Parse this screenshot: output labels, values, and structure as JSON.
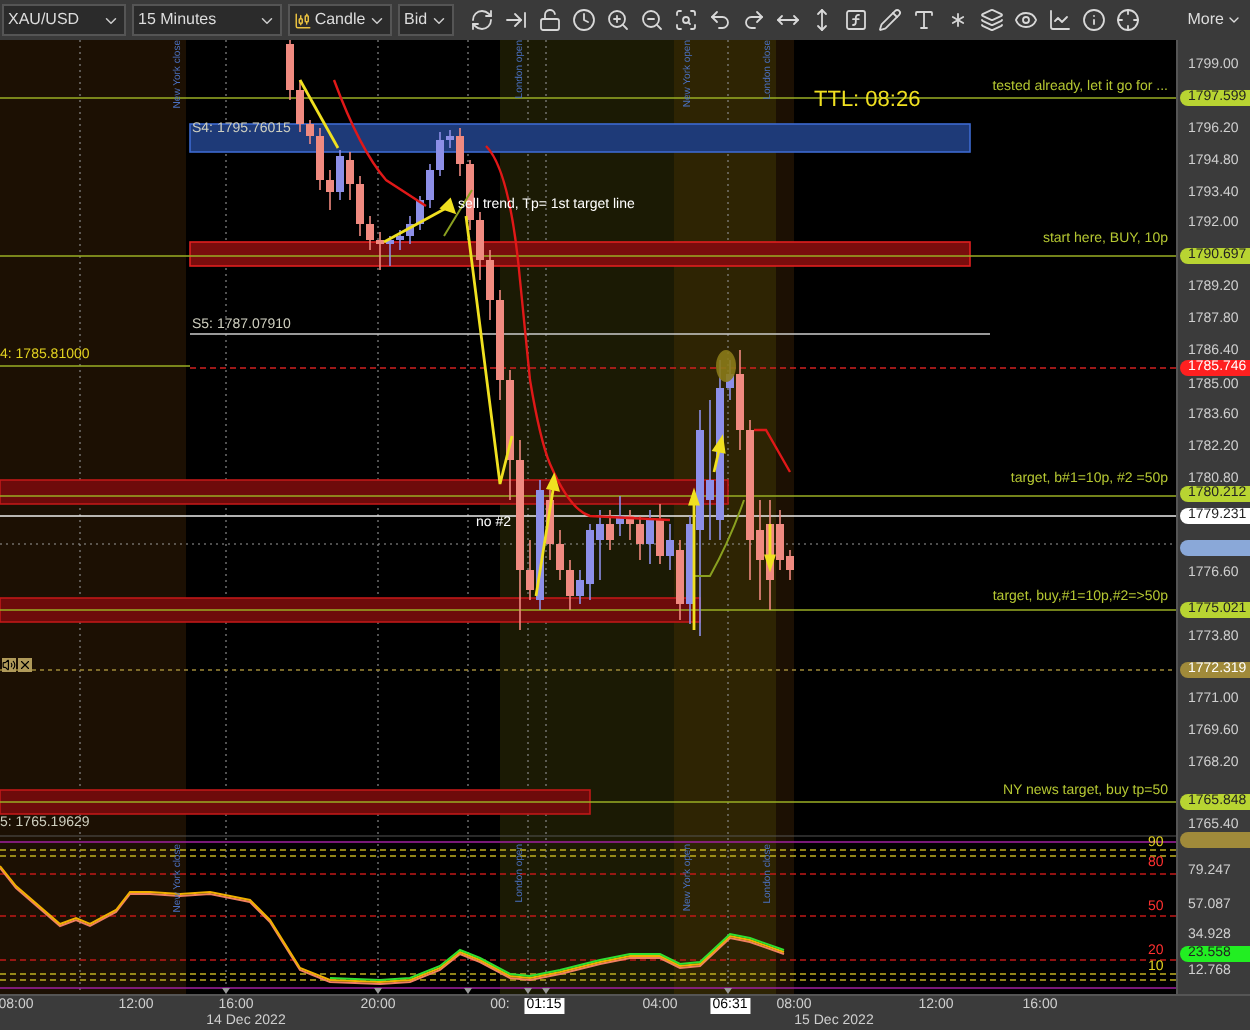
{
  "toolbar": {
    "symbol": "XAU/USD",
    "timeframe": "15 Minutes",
    "chart_type": "Candle",
    "price_side": "Bid",
    "more": "More"
  },
  "chart": {
    "timer": "TTL: 08:26",
    "notes": [
      {
        "text": "S4: 1795.76015",
        "kind": "level"
      },
      {
        "text": "sell trend, Tp= 1st target line",
        "kind": "comment"
      },
      {
        "text": "S5: 1787.07910",
        "kind": "level"
      },
      {
        "text": "4: 1785.81000",
        "kind": "edge"
      },
      {
        "text": "no #2",
        "kind": "comment"
      },
      {
        "text": "5: 1765.19629",
        "kind": "level"
      }
    ],
    "line_notes": [
      "tested already, let it go for ...",
      "start here, BUY, 10p",
      "target, b#1=10p, #2 =50p",
      "target, buy,#1=10p,#2=>50p",
      "NY news target, buy tp=50"
    ],
    "session_labels": [
      "New York close",
      "London open",
      "New York open",
      "London close"
    ]
  },
  "indicator": {
    "session_labels": [
      "New York close",
      "London open",
      "New York open",
      "London close"
    ],
    "levels": [
      {
        "label": "90",
        "color": "#e0d020"
      },
      {
        "label": "80",
        "color": "#ff3030"
      },
      {
        "label": "50",
        "color": "#ff3030"
      },
      {
        "label": "20",
        "color": "#ff3030"
      },
      {
        "label": "10",
        "color": "#e0d020"
      }
    ]
  },
  "price_axis": {
    "ticks": [
      "1799.00",
      "1796.20",
      "1794.80",
      "1793.40",
      "1792.00",
      "1789.20",
      "1787.80",
      "1786.40",
      "1785.00",
      "1783.60",
      "1782.20",
      "1780.80",
      "1776.60",
      "1773.80",
      "1771.00",
      "1769.60",
      "1768.20",
      "1765.40"
    ],
    "tags": [
      {
        "label": "1797.599",
        "color": "#b8d432"
      },
      {
        "label": "1790.697",
        "color": "#b8d432"
      },
      {
        "label": "1785.746",
        "color": "#ff2020"
      },
      {
        "label": "1780.212",
        "color": "#b8d432"
      },
      {
        "label": "1779.231",
        "color": "#ffffff"
      },
      {
        "color": "#8aa8d8"
      },
      {
        "label": "1775.021",
        "color": "#b8d432"
      },
      {
        "label": "1772.319",
        "color": "#a08a3a"
      },
      {
        "label": "1765.848",
        "color": "#b8d432"
      },
      {
        "color": "#a08a3a"
      }
    ]
  },
  "indicator_axis": {
    "ticks": [
      "79.247",
      "57.087",
      "34.928",
      "12.768"
    ],
    "tags": [
      {
        "label": "23.558",
        "color": "#22ee22"
      }
    ]
  },
  "time_axis": {
    "times": [
      {
        "label": "08:00",
        "kind": "plain"
      },
      {
        "label": "12:00",
        "kind": "plain"
      },
      {
        "label": "16:00",
        "kind": "plain"
      },
      {
        "label": "20:00",
        "kind": "plain"
      },
      {
        "label": "00:",
        "kind": "plain"
      },
      {
        "label": "01:15",
        "kind": "marker"
      },
      {
        "label": "04:00",
        "kind": "plain"
      },
      {
        "label": "06:31",
        "kind": "marker"
      },
      {
        "label": "08:00",
        "kind": "plain"
      },
      {
        "label": "12:00",
        "kind": "plain"
      },
      {
        "label": "16:00",
        "kind": "plain"
      }
    ],
    "dates": [
      "14 Dec 2022",
      "15 Dec 2022"
    ]
  }
}
